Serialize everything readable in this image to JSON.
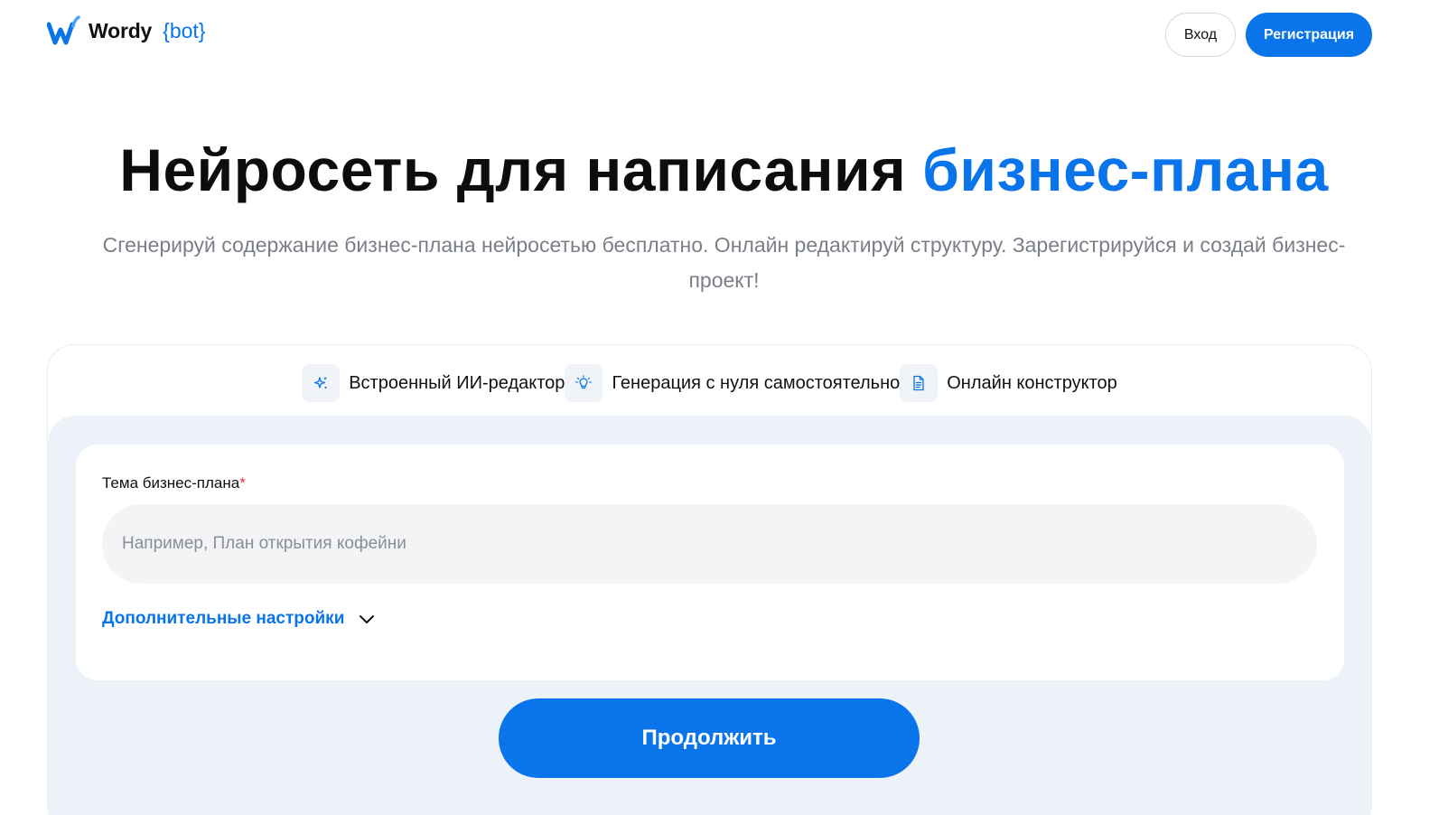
{
  "header": {
    "logo_word": "Wordy",
    "logo_bot": "{bot}",
    "login_label": "Вход",
    "register_label": "Регистрация"
  },
  "hero": {
    "title_main": "Нейросеть для написания",
    "title_accent": "бизнес-плана",
    "subtitle": "Сгенерируй содержание бизнес-плана нейросетью бесплатно. Онлайн редактируй структуру. Зарегистрируйся и создай бизнес-проект!"
  },
  "features": [
    {
      "icon": "sparkles-icon",
      "label": "Встроенный ИИ-редактор"
    },
    {
      "icon": "lightbulb-icon",
      "label": "Генерация с нуля самостоятельно"
    },
    {
      "icon": "document-icon",
      "label": "Онлайн конструктор"
    }
  ],
  "form": {
    "topic_label": "Тема бизнес-плана",
    "required_mark": "*",
    "topic_value": "",
    "topic_placeholder": "Например, План открытия кофейни",
    "more_settings_label": "Дополнительные настройки",
    "continue_label": "Продолжить"
  },
  "colors": {
    "accent": "#0a74ea",
    "panel_bg": "#edf2f9",
    "input_bg": "#f3f4f6",
    "subtitle": "#7a7f87",
    "required": "#e0323c"
  }
}
